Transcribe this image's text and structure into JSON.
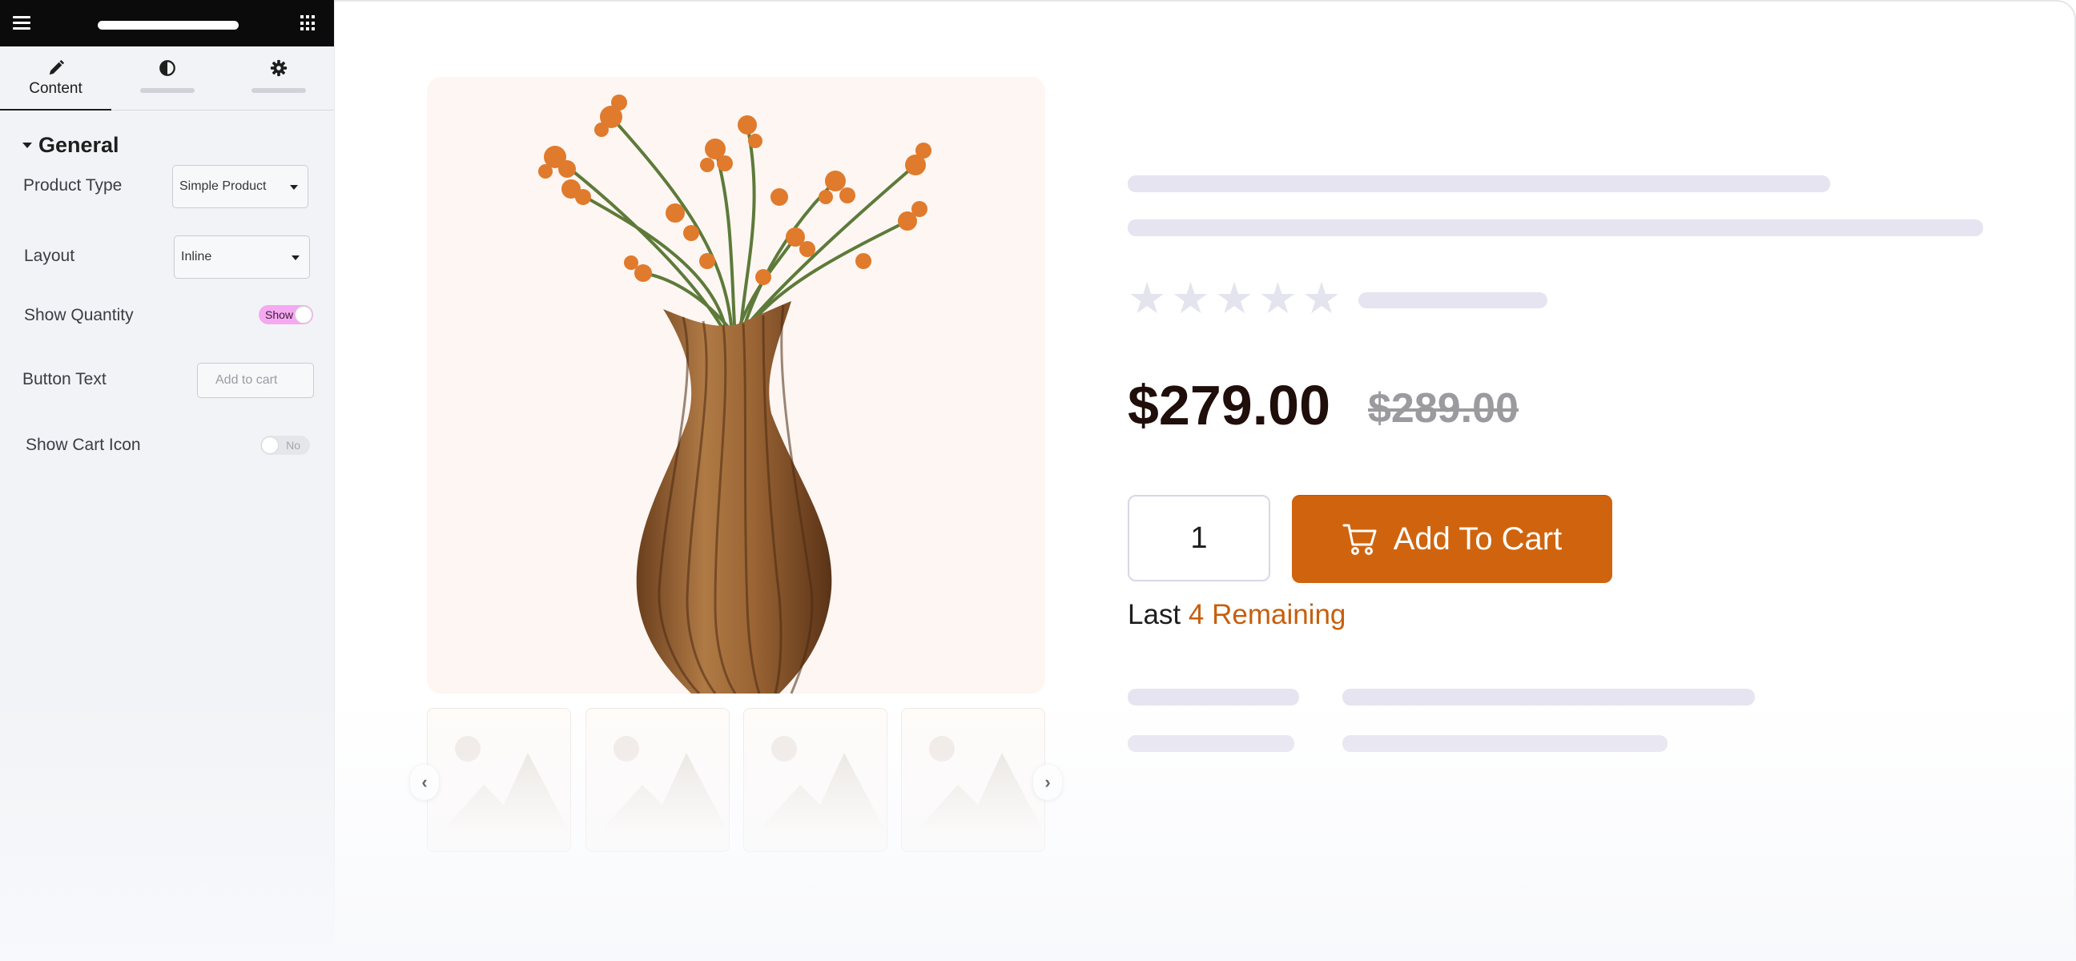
{
  "sidebar": {
    "tabs": [
      {
        "label": "Content",
        "icon": "pencil-icon",
        "active": true
      },
      {
        "label": "",
        "icon": "contrast-icon",
        "active": false
      },
      {
        "label": "",
        "icon": "gear-icon",
        "active": false
      }
    ],
    "section_title": "General",
    "controls": {
      "product_type": {
        "label": "Product Type",
        "value": "Simple Product"
      },
      "layout": {
        "label": "Layout",
        "value": "Inline"
      },
      "show_quantity": {
        "label": "Show Quantity",
        "value": "Show",
        "on": true
      },
      "button_text": {
        "label": "Button Text",
        "placeholder": "Add to cart"
      },
      "show_cart_icon": {
        "label": "Show Cart Icon",
        "value": "No",
        "on": false
      }
    }
  },
  "product": {
    "price": "$279.00",
    "old_price": "$289.00",
    "rating_stars": 5,
    "quantity": "1",
    "add_to_cart_label": "Add To Cart",
    "stock": {
      "prefix": "Last",
      "highlight": "4 Remaining"
    }
  },
  "colors": {
    "accent": "#d0640e",
    "toggle_on": "#f4a9f0",
    "skeleton": "#e6e4f0",
    "topbar": "#0b0b0c"
  }
}
